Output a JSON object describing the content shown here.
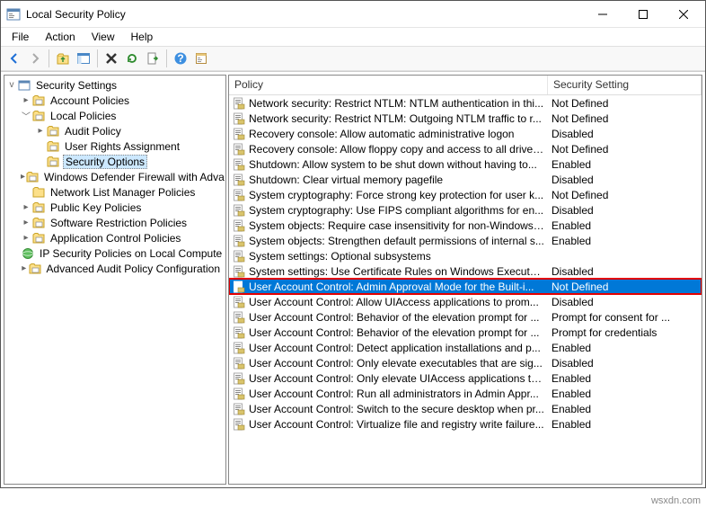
{
  "window": {
    "title": "Local Security Policy"
  },
  "menu": [
    "File",
    "Action",
    "View",
    "Help"
  ],
  "tree": {
    "root": "Security Settings",
    "items": [
      {
        "label": "Account Policies",
        "depth": 1,
        "toggle": ">",
        "icon": "folder"
      },
      {
        "label": "Local Policies",
        "depth": 1,
        "toggle": "v",
        "icon": "folder"
      },
      {
        "label": "Audit Policy",
        "depth": 2,
        "toggle": ">",
        "icon": "folder"
      },
      {
        "label": "User Rights Assignment",
        "depth": 2,
        "toggle": "",
        "icon": "folder"
      },
      {
        "label": "Security Options",
        "depth": 2,
        "toggle": "",
        "icon": "folder",
        "selected": true
      },
      {
        "label": "Windows Defender Firewall with Adva",
        "depth": 1,
        "toggle": ">",
        "icon": "folder"
      },
      {
        "label": "Network List Manager Policies",
        "depth": 1,
        "toggle": "",
        "icon": "folderplain"
      },
      {
        "label": "Public Key Policies",
        "depth": 1,
        "toggle": ">",
        "icon": "folder"
      },
      {
        "label": "Software Restriction Policies",
        "depth": 1,
        "toggle": ">",
        "icon": "folder"
      },
      {
        "label": "Application Control Policies",
        "depth": 1,
        "toggle": ">",
        "icon": "folder"
      },
      {
        "label": "IP Security Policies on Local Compute",
        "depth": 1,
        "toggle": "",
        "icon": "ipsec"
      },
      {
        "label": "Advanced Audit Policy Configuration",
        "depth": 1,
        "toggle": ">",
        "icon": "folder"
      }
    ]
  },
  "list": {
    "headers": {
      "policy": "Policy",
      "setting": "Security Setting"
    },
    "rows": [
      {
        "policy": "Network security: Restrict NTLM: NTLM authentication in thi...",
        "setting": "Not Defined"
      },
      {
        "policy": "Network security: Restrict NTLM: Outgoing NTLM traffic to r...",
        "setting": "Not Defined"
      },
      {
        "policy": "Recovery console: Allow automatic administrative logon",
        "setting": "Disabled"
      },
      {
        "policy": "Recovery console: Allow floppy copy and access to all drives...",
        "setting": "Not Defined"
      },
      {
        "policy": "Shutdown: Allow system to be shut down without having to...",
        "setting": "Enabled"
      },
      {
        "policy": "Shutdown: Clear virtual memory pagefile",
        "setting": "Disabled"
      },
      {
        "policy": "System cryptography: Force strong key protection for user k...",
        "setting": "Not Defined"
      },
      {
        "policy": "System cryptography: Use FIPS compliant algorithms for en...",
        "setting": "Disabled"
      },
      {
        "policy": "System objects: Require case insensitivity for non-Windows ...",
        "setting": "Enabled"
      },
      {
        "policy": "System objects: Strengthen default permissions of internal s...",
        "setting": "Enabled"
      },
      {
        "policy": "System settings: Optional subsystems",
        "setting": ""
      },
      {
        "policy": "System settings: Use Certificate Rules on Windows Executab...",
        "setting": "Disabled"
      },
      {
        "policy": "User Account Control: Admin Approval Mode for the Built-i...",
        "setting": "Not Defined",
        "selected": true
      },
      {
        "policy": "User Account Control: Allow UIAccess applications to prom...",
        "setting": "Disabled"
      },
      {
        "policy": "User Account Control: Behavior of the elevation prompt for ...",
        "setting": "Prompt for consent for ..."
      },
      {
        "policy": "User Account Control: Behavior of the elevation prompt for ...",
        "setting": "Prompt for credentials"
      },
      {
        "policy": "User Account Control: Detect application installations and p...",
        "setting": "Enabled"
      },
      {
        "policy": "User Account Control: Only elevate executables that are sig...",
        "setting": "Disabled"
      },
      {
        "policy": "User Account Control: Only elevate UIAccess applications th...",
        "setting": "Enabled"
      },
      {
        "policy": "User Account Control: Run all administrators in Admin Appr...",
        "setting": "Enabled"
      },
      {
        "policy": "User Account Control: Switch to the secure desktop when pr...",
        "setting": "Enabled"
      },
      {
        "policy": "User Account Control: Virtualize file and registry write failure...",
        "setting": "Enabled"
      }
    ]
  },
  "watermark": "wsxdn.com"
}
